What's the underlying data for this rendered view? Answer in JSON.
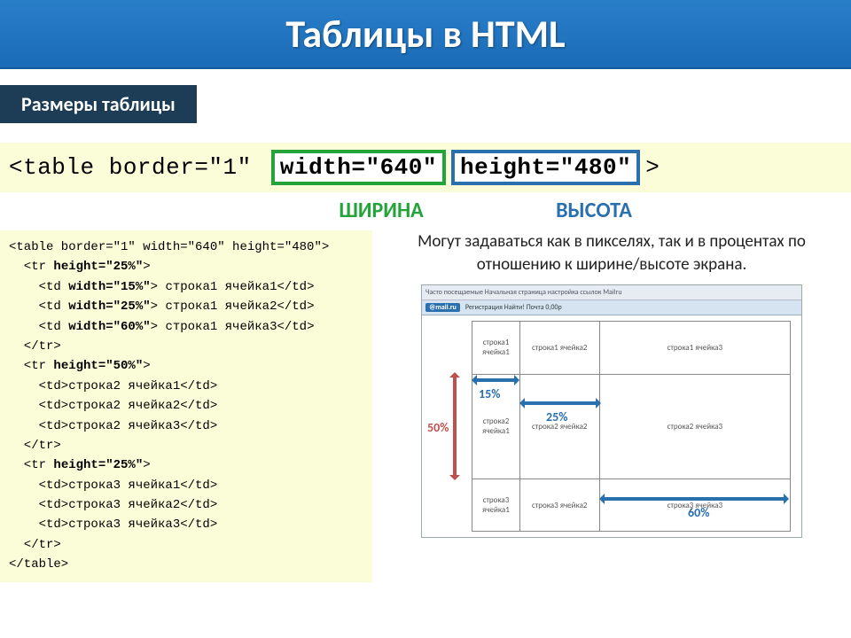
{
  "header": {
    "title": "Таблицы в HTML"
  },
  "section": {
    "label": "Размеры таблицы"
  },
  "tagline": {
    "prefix": "<table border=\"1\" ",
    "width_attr": "width=\"640\"",
    "height_attr": "height=\"480\"",
    "suffix": ">"
  },
  "labels": {
    "width": "ШИРИНА",
    "height": "ВЫСОТА"
  },
  "code": {
    "lines": [
      "<table border=\"1\" width=\"640\" height=\"480\">",
      "  <tr height=\"25%\">",
      "    <td width=\"15%\"> строка1 ячейка1</td>",
      "    <td width=\"25%\"> строка1 ячейка2</td>",
      "    <td width=\"60%\"> строка1 ячейка3</td>",
      "  </tr>",
      "",
      "  <tr height=\"50%\">",
      "    <td>строка2 ячейка1</td>",
      "    <td>строка2 ячейка2</td>",
      "    <td>строка2 ячейка3</td>",
      "  </tr>",
      "",
      "  <tr height=\"25%\">",
      "    <td>строка3 ячейка1</td>",
      "    <td>строка3 ячейка2</td>",
      "    <td>строка3 ячейка3</td>",
      "  </tr>",
      "</table>"
    ],
    "bold_attrs": [
      "height=\"25%\"",
      "width=\"15%\"",
      "width=\"25%\"",
      "width=\"60%\"",
      "height=\"50%\"",
      "height=\"25%\""
    ]
  },
  "description": "Могут задаваться как в пикселях, так и в процентах по отношению к ширине/высоте экрана.",
  "browser": {
    "bar1": "Часто посещаемые   Начальная страница   настройка ссылок   Mailru",
    "bar2_brand": "@mail.ru",
    "bar2_rest": "Регистрация   Найти!   Почта   0,00р"
  },
  "demo_cells": {
    "r1c1": "строка1 ячейка1",
    "r1c2": "строка1 ячейка2",
    "r1c3": "строка1 ячейка3",
    "r2c1": "строка2 ячейка1",
    "r2c2": "строка2 ячейка2",
    "r2c3": "строка2 ячейка3",
    "r3c1": "строка3 ячейка1",
    "r3c2": "строка3 ячейка2",
    "r3c3": "строка3 ячейка3"
  },
  "percents": {
    "p15": "15%",
    "p25": "25%",
    "p50": "50%",
    "p60": "60%"
  }
}
